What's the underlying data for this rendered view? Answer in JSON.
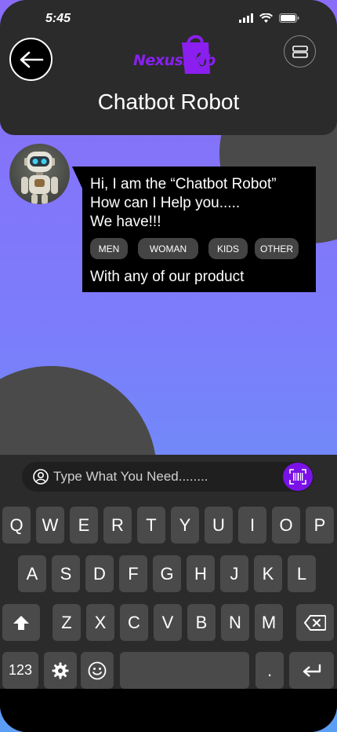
{
  "status_bar": {
    "time": "5:45"
  },
  "header": {
    "logo_text": "NexusHub",
    "title": "Chatbot Robot"
  },
  "chat": {
    "message_lines": [
      "Hi, I am the “Chatbot Robot”",
      "How can I Help you.....",
      "We have!!!"
    ],
    "categories": [
      "MEN",
      "WOMAN",
      "KIDS",
      "OTHER"
    ],
    "closing_line": "With any of our product"
  },
  "input": {
    "placeholder": "Type What You Need........"
  },
  "keyboard": {
    "row1": [
      "Q",
      "W",
      "E",
      "R",
      "T",
      "Y",
      "U",
      "I",
      "O",
      "P"
    ],
    "row2": [
      "A",
      "S",
      "D",
      "F",
      "G",
      "H",
      "J",
      "K",
      "L"
    ],
    "row3": [
      "Z",
      "X",
      "C",
      "V",
      "B",
      "N",
      "M"
    ],
    "numbers_key": "123",
    "period_key": "."
  },
  "colors": {
    "accent": "#7a12e8",
    "background_top": "#8a6cf8",
    "background_bottom": "#5aa2f3",
    "panel": "#2b2b2b"
  }
}
